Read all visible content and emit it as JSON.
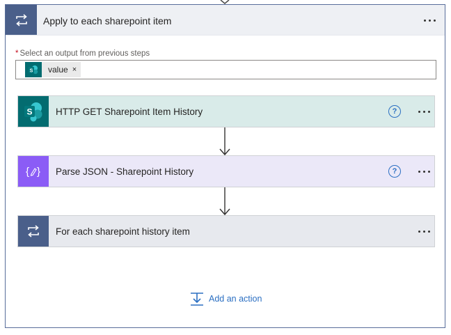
{
  "loop": {
    "title": "Apply to each sharepoint item",
    "field_label": "Select an output from previous steps",
    "required_marker": "*",
    "token": {
      "label": "value",
      "remove": "×"
    }
  },
  "steps": [
    {
      "title": "HTTP GET Sharepoint Item History",
      "help": "?"
    },
    {
      "title": "Parse JSON - Sharepoint History",
      "help": "?"
    },
    {
      "title": "For each sharepoint history item"
    }
  ],
  "add_action": {
    "label": "Add an action"
  },
  "colors": {
    "sharepoint": "#036c70",
    "parse_json": "#8b5cf6",
    "loop": "#4a5f8a",
    "link": "#2b6fc2"
  }
}
